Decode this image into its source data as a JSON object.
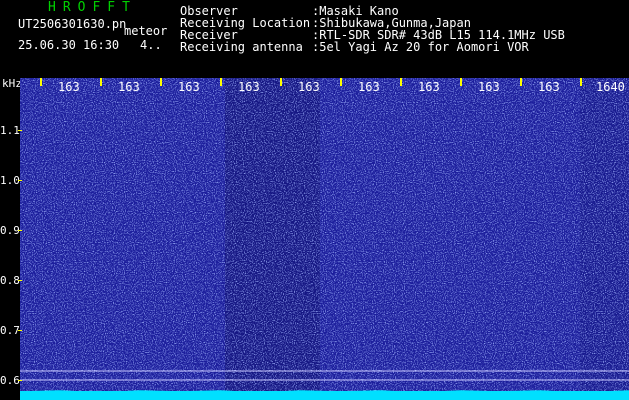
{
  "header": {
    "app_title": "HROFFT",
    "filename": "UT2506301630.pn",
    "meteor_label": "meteor",
    "datetime": "25.06.30 16:30",
    "count": "4..",
    "info": [
      {
        "label": "Observer",
        "value": ":Masaki Kano"
      },
      {
        "label": "Receiving Location",
        "value": ":Shibukawa,Gunma,Japan"
      },
      {
        "label": "Receiver",
        "value": ":RTL-SDR SDR# 43dB L15 114.1MHz USB"
      },
      {
        "label": "Receiving antenna",
        "value": ":5el Yagi Az 20 for Aomori VOR"
      }
    ]
  },
  "plot": {
    "y_unit": "kHz",
    "y_labels": [
      "1.1",
      "1.0",
      "0.9",
      "0.8",
      "0.7",
      "0.6"
    ],
    "x_labels": [
      "163",
      "163",
      "163",
      "163",
      "163",
      "163",
      "163",
      "163",
      "163",
      "1640"
    ],
    "colors": {
      "background": "#1c1e9c",
      "noise": "#4a5cff",
      "baseline": "#00e0ff",
      "ticks": "#ffff00"
    }
  }
}
